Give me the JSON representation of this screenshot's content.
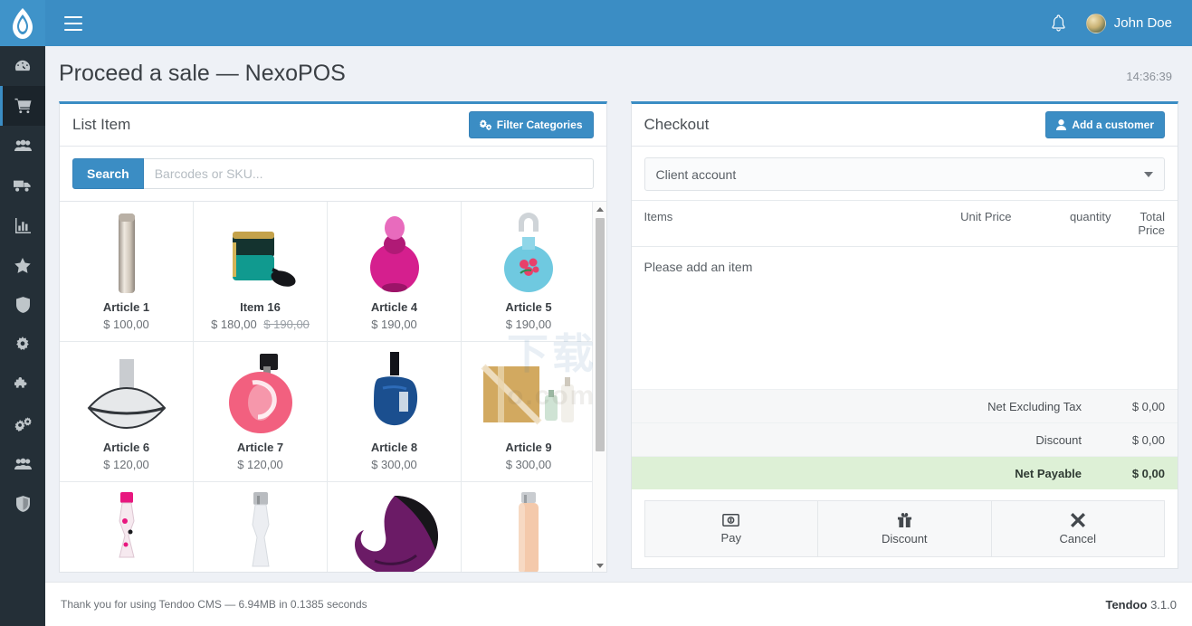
{
  "app": {
    "logo_icon": "flame-logo-icon",
    "menu_toggle_icon": "hamburger-menu-icon",
    "notification_icon": "bell-icon",
    "user_name": "John Doe",
    "accent_color": "#3b8dc4",
    "sidebar_color": "#242f37",
    "payable_highlight_color": "#ddf0d6"
  },
  "sidebar": {
    "items": [
      {
        "name": "dashboard",
        "icon": "speedometer-icon",
        "active": false
      },
      {
        "name": "pos-sale",
        "icon": "shopping-cart-icon",
        "active": true
      },
      {
        "name": "customers",
        "icon": "users-icon",
        "active": false
      },
      {
        "name": "shipping",
        "icon": "truck-icon",
        "active": false
      },
      {
        "name": "reports",
        "icon": "bar-chart-icon",
        "active": false
      },
      {
        "name": "favorites",
        "icon": "star-icon",
        "active": false
      },
      {
        "name": "security",
        "icon": "shield-icon",
        "active": false
      },
      {
        "name": "settings",
        "icon": "gear-icon",
        "active": false
      },
      {
        "name": "modules",
        "icon": "puzzle-icon",
        "active": false
      },
      {
        "name": "options",
        "icon": "cogs-icon",
        "active": false
      },
      {
        "name": "user-groups",
        "icon": "users-group-icon",
        "active": false
      },
      {
        "name": "permissions",
        "icon": "shield-alt-icon",
        "active": false
      }
    ]
  },
  "page": {
    "title": "Proceed a sale — NexoPOS",
    "clock": "14:36:39"
  },
  "list_panel": {
    "title": "List Item",
    "filter_button": {
      "label": "Filter Categories",
      "icon": "sliders-gear-icon"
    },
    "search_button": "Search",
    "search_placeholder": "Barcodes or SKU...",
    "products": [
      {
        "name": "Article 1",
        "price": "$ 100,00",
        "old_price": "",
        "image": "silver-cylinder-bottle"
      },
      {
        "name": "Item 16",
        "price": "$ 180,00",
        "old_price": "$ 190,00",
        "image": "teal-tassel-bottle"
      },
      {
        "name": "Article 4",
        "price": "$ 190,00",
        "old_price": "",
        "image": "pink-round-bottle"
      },
      {
        "name": "Article 5",
        "price": "$ 190,00",
        "old_price": "",
        "image": "blue-floral-bottle"
      },
      {
        "name": "Article 6",
        "price": "$ 120,00",
        "old_price": "",
        "image": "silver-leaf-bottle"
      },
      {
        "name": "Article 7",
        "price": "$ 120,00",
        "old_price": "",
        "image": "pink-apple-bottle"
      },
      {
        "name": "Article 8",
        "price": "$ 300,00",
        "old_price": "",
        "image": "blue-fist-bottle"
      },
      {
        "name": "Article 9",
        "price": "$ 300,00",
        "old_price": "",
        "image": "gold-gift-box-set"
      },
      {
        "name": "",
        "price": "",
        "old_price": "",
        "image": "pink-slim-bottle"
      },
      {
        "name": "",
        "price": "",
        "old_price": "",
        "image": "white-tall-bottle"
      },
      {
        "name": "",
        "price": "",
        "old_price": "",
        "image": "purple-crescent-bottle"
      },
      {
        "name": "",
        "price": "",
        "old_price": "",
        "image": "peach-rect-bottle"
      }
    ]
  },
  "checkout": {
    "title": "Checkout",
    "add_customer_button": {
      "label": "Add a customer",
      "icon": "user-icon"
    },
    "client_select": {
      "value": "Client account",
      "icon": "chevron-down-icon"
    },
    "columns": [
      "Items",
      "Unit Price",
      "quantity",
      "Total Price"
    ],
    "empty_message": "Please add an item",
    "totals": [
      {
        "label": "Net Excluding Tax",
        "value": "$ 0,00",
        "highlight": false
      },
      {
        "label": "Discount",
        "value": "$ 0,00",
        "highlight": false
      },
      {
        "label": "Net Payable",
        "value": "$ 0,00",
        "highlight": true
      }
    ],
    "actions": [
      {
        "label": "Pay",
        "icon": "money-bill-icon"
      },
      {
        "label": "Discount",
        "icon": "gift-icon"
      },
      {
        "label": "Cancel",
        "icon": "times-icon"
      }
    ]
  },
  "watermark": {
    "top": "下载",
    "bottom": "o.com"
  },
  "footer": {
    "left": "Thank you for using Tendoo CMS — 6.94MB in 0.1385 seconds",
    "brand": "Tendoo",
    "version": "3.1.0"
  }
}
